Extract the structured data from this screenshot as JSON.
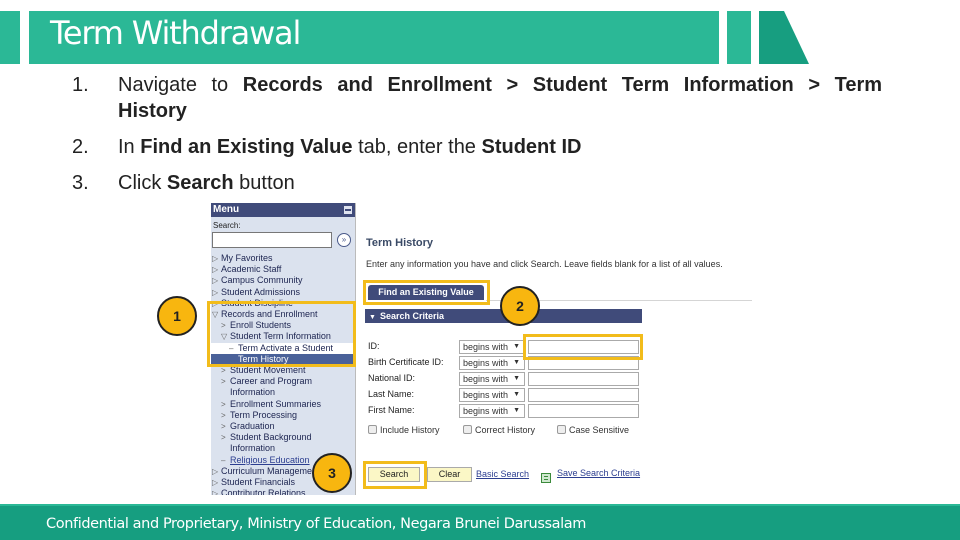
{
  "header": {
    "title": "Term Withdrawal",
    "colors": {
      "primary": "#2bb896",
      "dark": "#179e80"
    }
  },
  "steps": [
    {
      "num": "1.",
      "prefix": "Navigate to ",
      "b1": "Records and Enrollment",
      "sep1": " > ",
      "b2": "Student Term Information",
      "sep2": " > ",
      "b3a": "Term",
      "b3b": "History"
    },
    {
      "num": "2.",
      "prefix": "In ",
      "b1": "Find an Existing Value",
      "mid": " tab, enter the ",
      "b2": "Student ID"
    },
    {
      "num": "3.",
      "prefix": "Click ",
      "b1": "Search",
      "suffix": " button"
    }
  ],
  "menu": {
    "title": "Menu",
    "search_label": "Search:",
    "search_value": "",
    "go_glyph": "»",
    "items": [
      {
        "label": "My Favorites",
        "twist": "▷"
      },
      {
        "label": "Academic Staff",
        "twist": "▷"
      },
      {
        "label": "Campus Community",
        "twist": "▷"
      },
      {
        "label": "Student Admissions",
        "twist": "▷"
      },
      {
        "label": "Student Discipline",
        "twist": "▷"
      },
      {
        "label": "Records and Enrollment",
        "twist": "▽"
      },
      {
        "label": "Enroll Students",
        "twist": ">"
      },
      {
        "label": "Student Term Information",
        "twist": "▽"
      },
      {
        "label": "Term Activate a Student",
        "twist": "–"
      },
      {
        "label": "Term History",
        "twist": ""
      },
      {
        "label": "Student Movement",
        "twist": ">"
      },
      {
        "label": "Career and Program",
        "twist": ">"
      },
      {
        "label": "Information",
        "twist": ""
      },
      {
        "label": "Enrollment Summaries",
        "twist": ">"
      },
      {
        "label": "Term Processing",
        "twist": ">"
      },
      {
        "label": "Graduation",
        "twist": ">"
      },
      {
        "label": "Student Background",
        "twist": ">"
      },
      {
        "label": "Information",
        "twist": ""
      },
      {
        "label": "Religious Education",
        "twist": "–"
      },
      {
        "label": "Curriculum Management",
        "twist": "▷"
      },
      {
        "label": "Student Financials",
        "twist": "▷"
      },
      {
        "label": "Contributor Relations",
        "twist": "▷"
      }
    ]
  },
  "page": {
    "title": "Term History",
    "description": "Enter any information you have and click Search. Leave fields blank for a list of all values.",
    "tab_label": "Find an Existing Value",
    "criteria_label": "Search Criteria",
    "fields": [
      {
        "label": "ID:",
        "operator": "begins with",
        "value": ""
      },
      {
        "label": "Birth Certificate ID:",
        "operator": "begins with",
        "value": ""
      },
      {
        "label": "National ID:",
        "operator": "begins with",
        "value": ""
      },
      {
        "label": "Last Name:",
        "operator": "begins with",
        "value": ""
      },
      {
        "label": "First Name:",
        "operator": "begins with",
        "value": ""
      }
    ],
    "checkboxes": [
      {
        "label": "Include History",
        "checked": false
      },
      {
        "label": "Correct History",
        "checked": false
      },
      {
        "label": "Case Sensitive",
        "checked": false
      }
    ],
    "buttons": {
      "search": "Search",
      "clear": "Clear"
    },
    "links": {
      "basic_search": "Basic Search",
      "save_criteria": "Save Search Criteria"
    }
  },
  "badges": [
    "1",
    "2",
    "3"
  ],
  "highlight_color": "#f2bc1b",
  "footer": {
    "text": "Confidential and Proprietary, Ministry of Education, Negara Brunei Darussalam"
  }
}
